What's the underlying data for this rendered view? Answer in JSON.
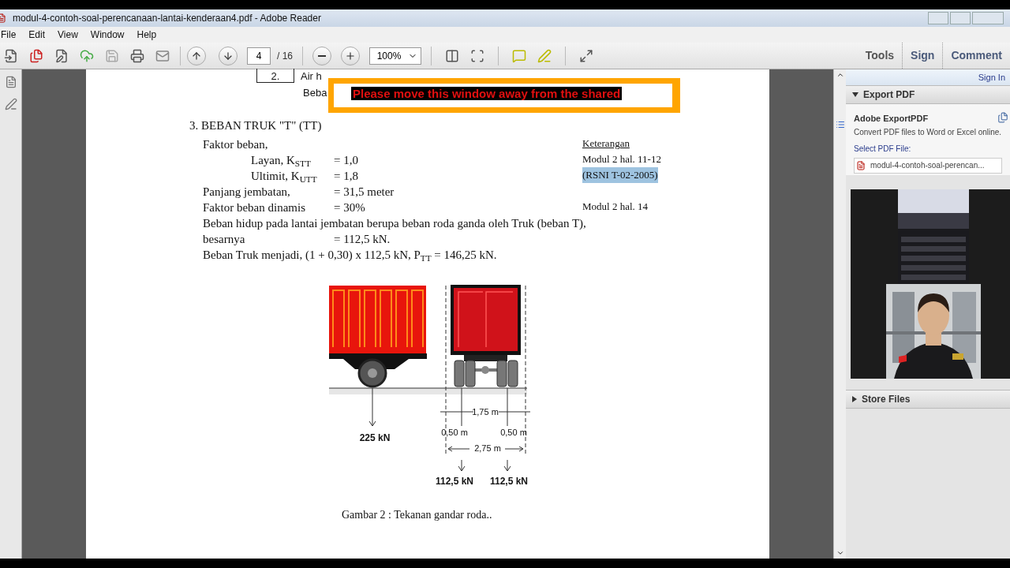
{
  "window": {
    "title": "modul-4-contoh-soal-perencanaan-lantai-kenderaan4.pdf - Adobe Reader"
  },
  "menu": [
    "File",
    "Edit",
    "View",
    "Window",
    "Help"
  ],
  "toolbar": {
    "page": "4",
    "page_total": "/ 16",
    "zoom": "100%"
  },
  "panel_tabs": [
    "Tools",
    "Sign",
    "Comment"
  ],
  "overlay_banner": "Please move this window away from the shared",
  "document": {
    "table_number": "2.",
    "table_cell": "Air h",
    "table_next": "Beba",
    "heading": "3. BEBAN TRUK \"T\" (TT)",
    "lines": [
      {
        "kind": "main",
        "label": "Faktor beban,",
        "note": "Keterangan",
        "underlined": true,
        "highlighted": false
      },
      {
        "kind": "sub",
        "label": "Layan, K$_{STT}$",
        "value": "= 1,0",
        "note": "Modul 2 hal. 11-12",
        "underlined": false,
        "highlighted": false
      },
      {
        "kind": "sub",
        "label": "Ultimit, K$_{UTT}$",
        "value": "= 1,8",
        "note": "(RSNI T-02-2005)",
        "underlined": false,
        "highlighted": true
      },
      {
        "kind": "main",
        "label": "Panjang jembatan,",
        "value": "= 31,5 meter"
      },
      {
        "kind": "main",
        "label": "Faktor beban dinamis",
        "value": "= 30%",
        "note": "Modul 2 hal. 14",
        "underlined": false,
        "highlighted": false
      },
      {
        "kind": "para",
        "label": "Beban hidup pada lantai jembatan berupa beban roda ganda oleh Truk (beban T),"
      },
      {
        "kind": "main",
        "label": "besarnya",
        "value": "= 112,5 kN."
      },
      {
        "kind": "para",
        "label": "Beban Truk menjadi, (1 + 0,30) x 112,5 kN,   P$_{TT}$ = 146,25 kN."
      }
    ],
    "figure": {
      "side_load": "225 kN",
      "track": "1,75 m",
      "edge_left": "0,50 m",
      "edge_right": "0,50 m",
      "width": "2,75 m",
      "wheel_left": "112,5 kN",
      "wheel_right": "112,5 kN",
      "caption": "Gambar 2 : Tekanan gandar roda.."
    }
  },
  "right_panel": {
    "sign_in": "Sign In",
    "sections": [
      {
        "title": "Export PDF",
        "expanded": true
      },
      {
        "title": "Store Files",
        "expanded": false
      }
    ],
    "export": {
      "heading": "Adobe ExportPDF",
      "text": "Convert PDF files to Word or Excel online.",
      "select_label": "Select PDF File:",
      "file": "modul-4-contoh-soal-perencan..."
    }
  }
}
